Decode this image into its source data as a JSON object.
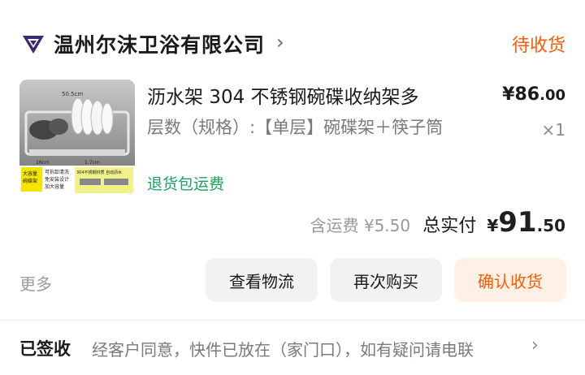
{
  "shop": {
    "name": "温州尔沫卫浴有限公司",
    "chevron": "›",
    "logo_icon": "shop-logo-icon"
  },
  "order": {
    "status": "待收货"
  },
  "product": {
    "title": "沥水架 304 不锈钢碗碟收纳架多",
    "spec": "层数（规格）:【单层】碗碟架＋筷子筒",
    "price_symbol": "¥",
    "price_int": "86",
    "price_dec": ".00",
    "quantity": "×1",
    "return_tag": "退货包运费",
    "thumbnail": {
      "dim_top": "50.5cm",
      "dim_side": "16cm",
      "dim_mid": "1.7cm",
      "badge_left": "大容量\n碗碟架",
      "feature_1": "可拆卸清洗",
      "feature_2": "免安装设计",
      "feature_3": "加大容量",
      "feature_4": "304不锈钢材质 自动沥水",
      "colors": {
        "badge": "#f5e400",
        "panel": "#f2f28a"
      }
    }
  },
  "totals": {
    "shipping": "含运费 ¥5.50",
    "label": "总实付",
    "symbol": "¥",
    "int": "91",
    "dec": ".50"
  },
  "actions": {
    "more": "更多",
    "logistics": "查看物流",
    "rebuy": "再次购买",
    "confirm": "确认收货"
  },
  "tracking": {
    "status": "已签收",
    "message": "经客户同意，快件已放在（家门口），如有疑问请电联",
    "chevron": "›"
  },
  "colors": {
    "accent": "#ff5a00",
    "accent_bg": "#fff0e5",
    "green": "#1aa35f",
    "button_bg": "#f2f2f2"
  }
}
